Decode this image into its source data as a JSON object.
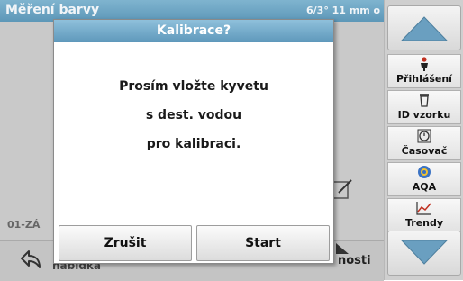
{
  "background": {
    "title": "Měření barvy",
    "header_right": "6/3°   11 mm o",
    "left_label": "01-ZÁ",
    "back_label": "nabídka",
    "right_button_label": "nosti"
  },
  "dialog": {
    "title": "Kalibrace?",
    "message_lines": [
      "Prosím vložte kyvetu",
      "s dest. vodou",
      "pro kalibraci."
    ],
    "cancel_label": "Zrušit",
    "start_label": "Start"
  },
  "sidebar": {
    "items": [
      {
        "label": "Přihlášení",
        "icon": "person-icon"
      },
      {
        "label": "ID vzorku",
        "icon": "sample-id-icon"
      },
      {
        "label": "Časovač",
        "icon": "timer-icon"
      },
      {
        "label": "AQA",
        "icon": "aqa-icon"
      },
      {
        "label": "Trendy",
        "icon": "trend-icon"
      }
    ]
  }
}
